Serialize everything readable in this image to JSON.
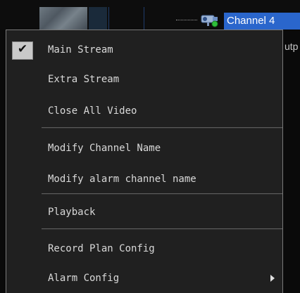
{
  "background": {
    "channel_label": "Channel 4",
    "right_peek_text": "utp"
  },
  "menu": {
    "items": [
      {
        "label": "Main Stream",
        "checked": true
      },
      {
        "label": "Extra Stream"
      },
      {
        "label": "Close All Video"
      },
      {
        "label": "Modify Channel Name"
      },
      {
        "label": "Modify alarm channel name"
      },
      {
        "label": "Playback"
      },
      {
        "label": "Record Plan Config"
      },
      {
        "label": "Alarm Config",
        "submenu": true
      }
    ],
    "check_icon": "checkmark-icon",
    "submenu_icon": "submenu-arrow-icon"
  },
  "colors": {
    "menu_background": "#202020",
    "menu_text": "#d9d9d9",
    "channel_highlight": "#2a66cc"
  }
}
